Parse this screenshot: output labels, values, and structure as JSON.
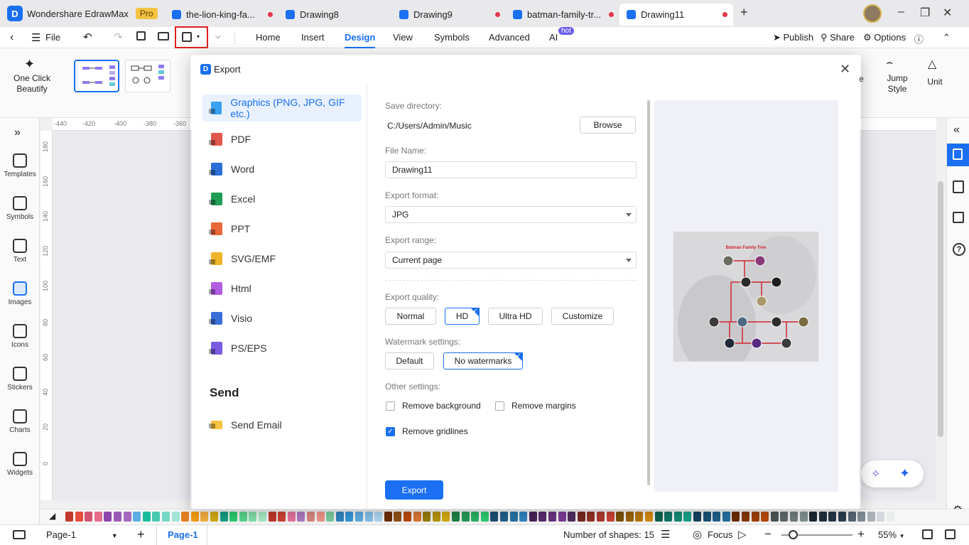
{
  "app": {
    "name": "Wondershare EdrawMax",
    "badge": "Pro"
  },
  "tabs": [
    {
      "label": "the-lion-king-fa...",
      "unsaved": true
    },
    {
      "label": "Drawing8",
      "unsaved": false
    },
    {
      "label": "Drawing9",
      "unsaved": true
    },
    {
      "label": "batman-family-tr...",
      "unsaved": true
    },
    {
      "label": "Drawing11",
      "unsaved": true,
      "active": true
    }
  ],
  "menu": {
    "file": "File",
    "items": [
      "Home",
      "Insert",
      "Design",
      "View",
      "Symbols",
      "Advanced",
      "AI"
    ],
    "active": "Design",
    "ai_badge": "hot",
    "publish": "Publish",
    "share": "Share",
    "options": "Options"
  },
  "ribbon": {
    "one_click_beautify": "One Click\nBeautify",
    "one_click_line1": "One Click",
    "one_click_line2": "Beautify",
    "jump_style_line1": "Jump",
    "jump_style_line2": "Style",
    "unit": "Unit",
    "partial_label": "e"
  },
  "ruler": {
    "h_ticks": [
      "-440",
      "-420",
      "-400",
      "-380",
      "-360"
    ],
    "v_ticks": [
      "180",
      "160",
      "140",
      "120",
      "100",
      "80",
      "60",
      "40",
      "20",
      "0"
    ]
  },
  "left_panel": [
    {
      "label": "Templates",
      "icon": "templates-icon"
    },
    {
      "label": "Symbols",
      "icon": "symbols-icon"
    },
    {
      "label": "Text",
      "icon": "text-icon"
    },
    {
      "label": "Images",
      "icon": "images-icon",
      "active": true
    },
    {
      "label": "Icons",
      "icon": "icons-icon"
    },
    {
      "label": "Stickers",
      "icon": "stickers-icon"
    },
    {
      "label": "Charts",
      "icon": "charts-icon"
    },
    {
      "label": "Widgets",
      "icon": "widgets-icon"
    }
  ],
  "dialog": {
    "title": "Export",
    "formats": [
      {
        "label": "Graphics (PNG, JPG, GIF etc.)",
        "color": "#3aa0f0",
        "selected": true
      },
      {
        "label": "PDF",
        "color": "#e2574c"
      },
      {
        "label": "Word",
        "color": "#2b6fd6"
      },
      {
        "label": "Excel",
        "color": "#1f9d55"
      },
      {
        "label": "PPT",
        "color": "#e8683a"
      },
      {
        "label": "SVG/EMF",
        "color": "#f0b429"
      },
      {
        "label": "Html",
        "color": "#b05ce0"
      },
      {
        "label": "Visio",
        "color": "#3b6fd8"
      },
      {
        "label": "PS/EPS",
        "color": "#7a5ce0"
      }
    ],
    "send_heading": "Send",
    "send_email": "Send Email",
    "save_directory_label": "Save directory:",
    "save_directory": "C:/Users/Admin/Music",
    "browse": "Browse",
    "file_name_label": "File Name:",
    "file_name": "Drawing11",
    "export_format_label": "Export format:",
    "export_format": "JPG",
    "export_range_label": "Export range:",
    "export_range": "Current page",
    "export_quality_label": "Export quality:",
    "quality_options": [
      "Normal",
      "HD",
      "Ultra HD",
      "Customize"
    ],
    "quality_selected": "HD",
    "watermark_label": "Watermark settings:",
    "watermark_options": [
      "Default",
      "No watermarks"
    ],
    "watermark_selected": "No watermarks",
    "other_label": "Other settings:",
    "remove_background": "Remove background",
    "remove_background_checked": false,
    "remove_margins": "Remove margins",
    "remove_margins_checked": false,
    "remove_gridlines": "Remove gridlines",
    "remove_gridlines_checked": true,
    "export_button": "Export",
    "preview_title": "Batman Family Tree"
  },
  "status": {
    "page_select": "Page-1",
    "page_tab": "Page-1",
    "shapes": "Number of shapes: 15",
    "focus": "Focus",
    "zoom": "55%"
  },
  "colors": {
    "accent": "#1a6ff2",
    "highlight_box": "#e02020",
    "preview_line": "#d0262e"
  }
}
